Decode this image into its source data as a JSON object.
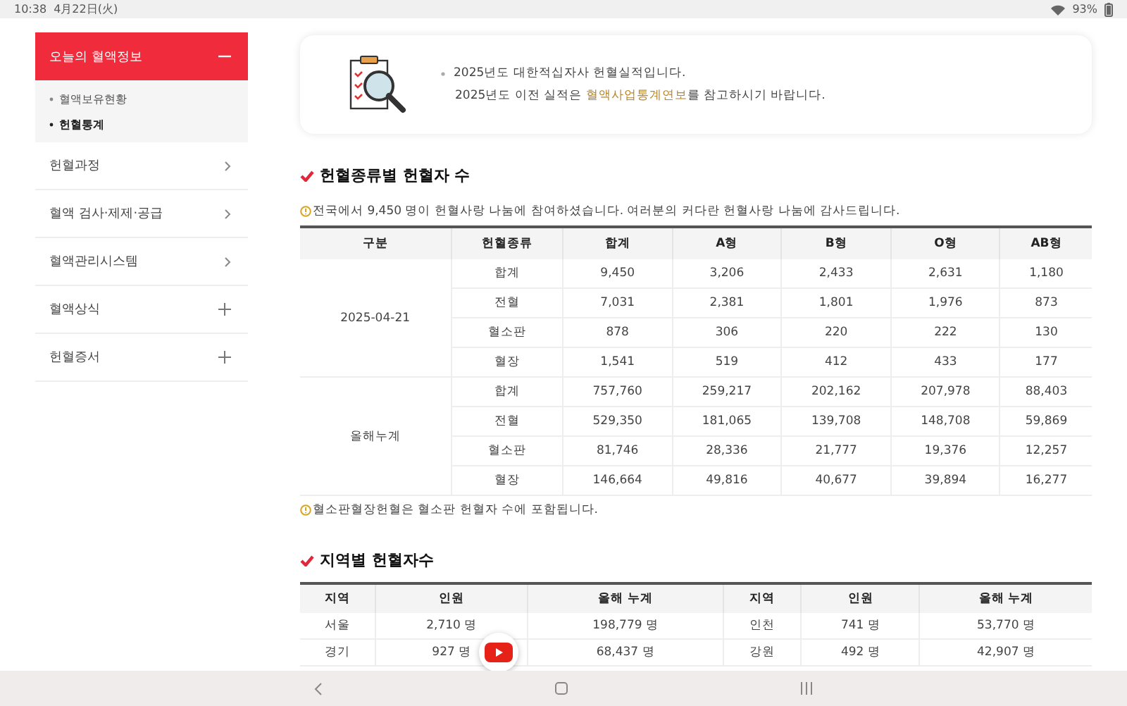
{
  "status_bar": {
    "time": "10:38",
    "date": "4月22日(火)",
    "battery": "93%"
  },
  "sidebar": {
    "items": [
      {
        "label": "오늘의 혈액정보",
        "kind": "group",
        "expanded": true,
        "children": [
          {
            "label": "혈액보유현황",
            "selected": false
          },
          {
            "label": "헌혈통계",
            "selected": true
          }
        ]
      },
      {
        "label": "헌혈과정",
        "kind": "link"
      },
      {
        "label": "혈액 검사·제제·공급",
        "kind": "link"
      },
      {
        "label": "혈액관리시스템",
        "kind": "link"
      },
      {
        "label": "혈액상식",
        "kind": "group",
        "expanded": false
      },
      {
        "label": "헌혈증서",
        "kind": "group",
        "expanded": false
      }
    ]
  },
  "info_card": {
    "line_1": "2025년도 대한적십자사 헌혈실적입니다.",
    "line_2_before": "2025년도 이전 실적은 ",
    "link": "혈액사업통계연보",
    "line_2_after": "를 참고하시기 바랍니다."
  },
  "section_1": {
    "title": "헌혈종류별 헌혈자 수",
    "note": "전국에서 9,450 명이 헌혈사랑 나눔에 참여하셨습니다. 여러분의 커다란 헌혈사랑 나눔에 감사드립니다.",
    "columns": [
      "구분",
      "헌혈종류",
      "합계",
      "A형",
      "B형",
      "O형",
      "AB형"
    ],
    "groups": [
      {
        "label": "2025-04-21",
        "rows": [
          [
            "합계",
            "9,450",
            "3,206",
            "2,433",
            "2,631",
            "1,180"
          ],
          [
            "전혈",
            "7,031",
            "2,381",
            "1,801",
            "1,976",
            "873"
          ],
          [
            "혈소판",
            "878",
            "306",
            "220",
            "222",
            "130"
          ],
          [
            "혈장",
            "1,541",
            "519",
            "412",
            "433",
            "177"
          ]
        ]
      },
      {
        "label": "올해누계",
        "rows": [
          [
            "합계",
            "757,760",
            "259,217",
            "202,162",
            "207,978",
            "88,403"
          ],
          [
            "전혈",
            "529,350",
            "181,065",
            "139,708",
            "148,708",
            "59,869"
          ],
          [
            "혈소판",
            "81,746",
            "28,336",
            "21,777",
            "19,376",
            "12,257"
          ],
          [
            "혈장",
            "146,664",
            "49,816",
            "40,677",
            "39,894",
            "16,277"
          ]
        ]
      }
    ],
    "footnote": "혈소판혈장헌혈은 혈소판 헌혈자 수에 포함됩니다."
  },
  "section_2": {
    "title": "지역별 헌혈자수",
    "columns": [
      "지역",
      "인원",
      "올해 누계",
      "지역",
      "인원",
      "올해 누계"
    ],
    "rows": [
      [
        "서울",
        "2,710 명",
        "198,779 명",
        "인천",
        "741 명",
        "53,770 명"
      ],
      [
        "경기",
        "927 명",
        "68,437 명",
        "강원",
        "492 명",
        "42,907 명"
      ]
    ]
  }
}
